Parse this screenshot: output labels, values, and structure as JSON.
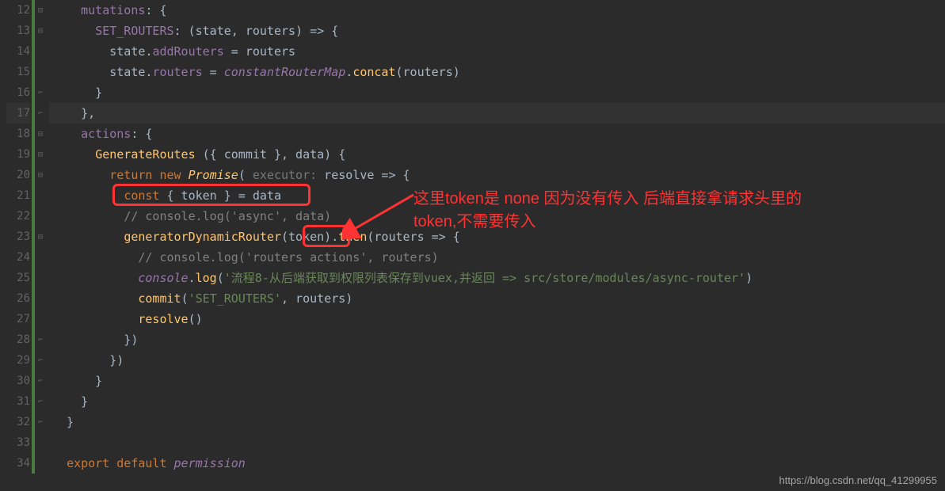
{
  "lines": {
    "12": "12",
    "13": "13",
    "14": "14",
    "15": "15",
    "16": "16",
    "17": "17",
    "18": "18",
    "19": "19",
    "20": "20",
    "21": "21",
    "22": "22",
    "23": "23",
    "24": "24",
    "25": "25",
    "26": "26",
    "27": "27",
    "28": "28",
    "29": "29",
    "30": "30",
    "31": "31",
    "32": "32",
    "33": "33",
    "34": "34"
  },
  "code": {
    "l12": {
      "indent": "    ",
      "prop": "mutations",
      "rest": ": {"
    },
    "l13": {
      "indent": "      ",
      "name": "SET_ROUTERS",
      "rest": ": (state, routers) => {"
    },
    "l14": {
      "indent": "        ",
      "t1": "state.",
      "prop": "addRouters",
      "t2": " = routers"
    },
    "l15": {
      "indent": "        ",
      "t1": "state.",
      "prop": "routers",
      "t2": " = ",
      "const": "constantRouterMap",
      "t3": ".",
      "fn": "concat",
      "t4": "(routers)"
    },
    "l16": "      }",
    "l17": "    },",
    "l18": {
      "indent": "    ",
      "prop": "actions",
      "rest": ": {"
    },
    "l19": {
      "indent": "      ",
      "fn": "GenerateRoutes",
      "rest": " ({ commit }, data) {"
    },
    "l20": {
      "indent": "        ",
      "kw1": "return ",
      "kw2": "new ",
      "cls": "Promise",
      "t1": "( ",
      "hint": "executor:",
      "t2": " resolve => {"
    },
    "l21": {
      "indent": "          ",
      "kw": "const",
      "rest": " { token } = data"
    },
    "l22": {
      "indent": "          ",
      "com": "// console.log('async', data)"
    },
    "l23": {
      "indent": "          ",
      "fn": "generatorDynamicRouter",
      "t1": "(token).",
      "fn2": "then",
      "t2": "(routers => {"
    },
    "l24": {
      "indent": "            ",
      "com": "// console.log('routers actions', routers)"
    },
    "l25": {
      "indent": "            ",
      "obj": "console",
      "t1": ".",
      "fn": "log",
      "t2": "(",
      "str": "'流程8-从后端获取到权限列表保存到vuex,并返回 => src/store/modules/async-router'",
      "t3": ")"
    },
    "l26": {
      "indent": "            ",
      "fn": "commit",
      "t1": "(",
      "str": "'SET_ROUTERS'",
      "t2": ", routers)"
    },
    "l27": {
      "indent": "            ",
      "fn": "resolve",
      "t1": "()"
    },
    "l28": "          })",
    "l29": "        })",
    "l30": "      }",
    "l31": "    }",
    "l32": "  }",
    "l33": "",
    "l34": {
      "indent": "  ",
      "kw": "export default ",
      "var": "permission"
    }
  },
  "annotation": {
    "line1": "这里token是 none 因为没有传入  后端直接拿请求头里的",
    "line2": "token,不需要传入"
  },
  "watermark": "https://blog.csdn.net/qq_41299955"
}
